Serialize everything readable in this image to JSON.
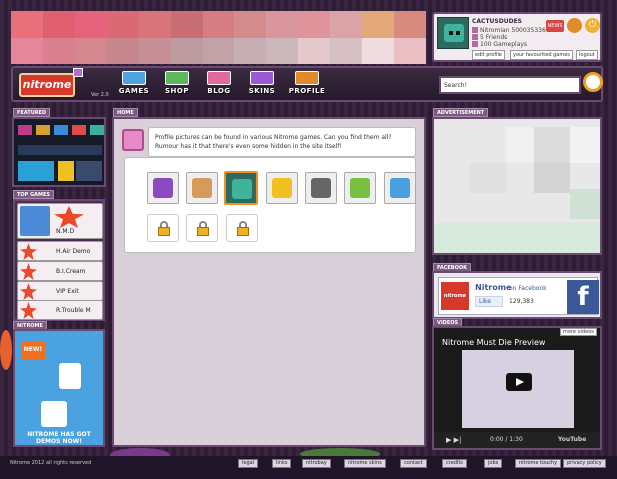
{
  "profile": {
    "username": "CACTUSDUDES",
    "nitromian": "Nitromian 500035336",
    "friends": "5 Friends",
    "gameplays": "100 Gameplays",
    "news_badge": "NEWS",
    "edit_profile": "edit profile",
    "favourite_games": "your favourited games",
    "logout": "logout"
  },
  "nav": {
    "logo": "nitrome",
    "version": "Ver 2.0",
    "items": [
      {
        "label": "GAMES",
        "color": "#4fa3e0"
      },
      {
        "label": "SHOP",
        "color": "#5cb85c"
      },
      {
        "label": "BLOG",
        "color": "#e06aa0"
      },
      {
        "label": "SKINS",
        "color": "#9a5ad6"
      },
      {
        "label": "PROFILE",
        "color": "#e08a2a"
      }
    ],
    "search_placeholder": "Search!"
  },
  "featured": {
    "title": "FEATURED"
  },
  "top_games": {
    "title": "TOP GAMES",
    "items": [
      "N.M.D",
      "H.Air Demo",
      "B.I.Cream",
      "VIP Exit",
      "R.Trouble M"
    ]
  },
  "left_ad": {
    "title": "NITROME",
    "new_label": "NEW!",
    "text": "NITROME HAS GOT DEMOS NOW!"
  },
  "main": {
    "title": "HOME",
    "intro": "Profile pictures can be found in various Nitrome games. Can you find them all? Rumour has it that there's even some hidden in the site itself!"
  },
  "advertisement": {
    "title": "ADVERTISEMENT"
  },
  "facebook": {
    "title": "FACEBOOK",
    "page_name": "Nitrome",
    "on_facebook": "on Facebook",
    "like": "Like",
    "count": "129,383",
    "logo_text": "nitrome"
  },
  "videos": {
    "title": "VIDEOS",
    "more": "more videos",
    "video_title": "Nitrome Must Die Preview",
    "time": "0:00 / 1:30",
    "youtube": "YouTube"
  },
  "footer": {
    "copyright": "Nitrome 2012 all rights reserved",
    "links": [
      "legal",
      "links",
      "nitrobay",
      "nitrome skins",
      "contact",
      "credits",
      "jobs",
      "nitrome touchy",
      "privacy policy"
    ]
  },
  "colors": {
    "accent": "#6b4a72",
    "panel": "#d9cfd8",
    "brand_red": "#d6382a"
  }
}
